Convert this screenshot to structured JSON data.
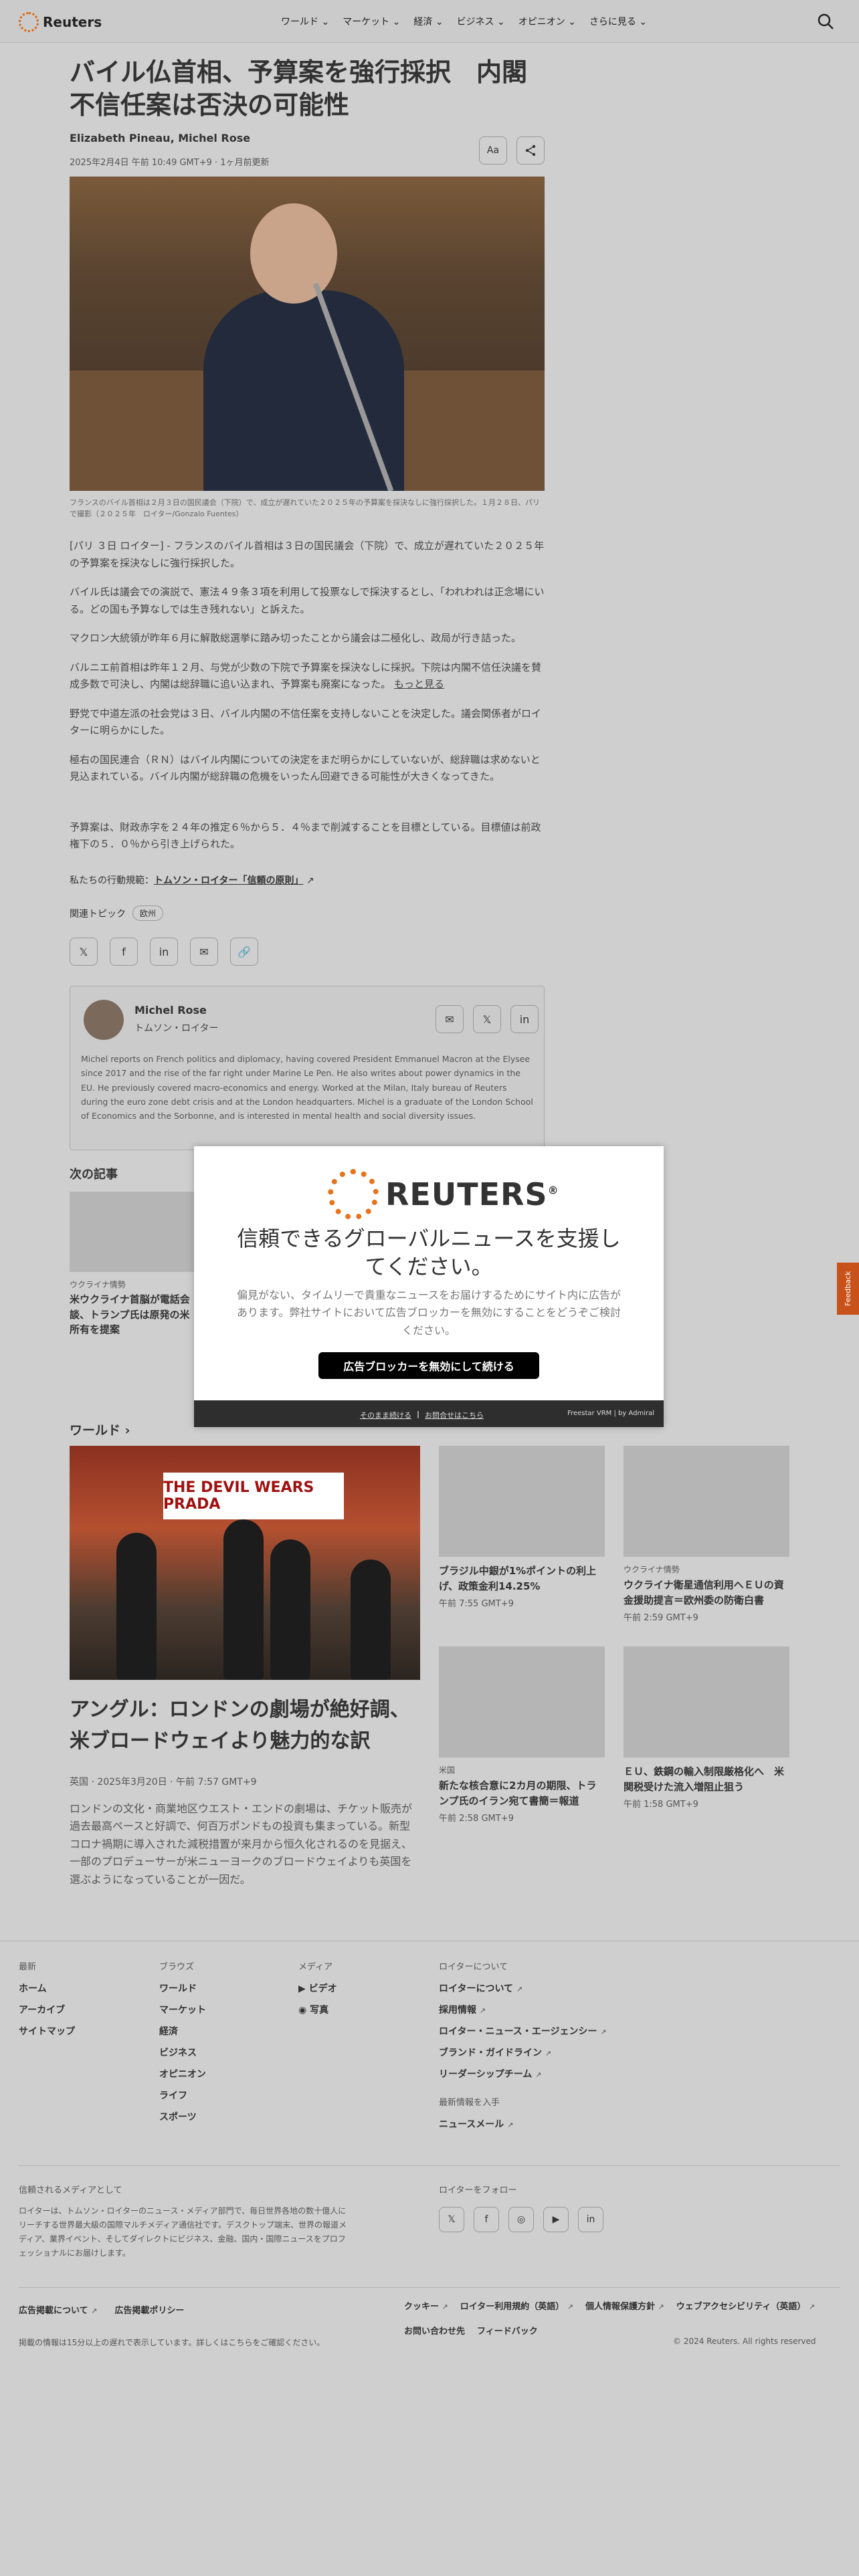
{
  "header": {
    "logo": "Reuters",
    "nav": [
      "ワールド ⌄",
      "マーケット ⌄",
      "経済 ⌄",
      "ビジネス ⌄",
      "オピニオン ⌄",
      "さらに見る ⌄"
    ],
    "search_icon": "search-icon"
  },
  "article": {
    "title": "バイル仏首相、予算案を強行採択　内閣不信任案は否決の可能性",
    "authors": "Elizabeth Pineau, Michel Rose",
    "dateline": "2025年2月4日 午前 10:49 GMT+9 · 1ヶ月前更新",
    "text_size_button": "Aa",
    "share_icon": "share-icon",
    "image_caption": "フランスのバイル首相は２月３日の国民議会（下院）で、成立が遅れていた２０２５年の予算案を採決なしに強行採択した。１月２８日、パリで撮影（２０２５年　ロイター/Gonzalo Fuentes）",
    "paragraphs": [
      "[パリ ３日 ロイター] - フランスのバイル首相は３日の国民議会（下院）で、成立が遅れていた２０２５年の予算案を採決なしに強行採択した。",
      "バイル氏は議会での演説で、憲法４９条３項を利用して投票なしで採決するとし、「われわれは正念場にいる。どの国も予算なしでは生き残れない」と訴えた。",
      "マクロン大統領が昨年６月に解散総選挙に踏み切ったことから議会は二極化し、政局が行き詰った。",
      "バルニエ前首相は昨年１２月、与党が少数の下院で予算案を採決なしに採択。下院は内閣不信任決議を賛成多数で可決し、内閣は総辞職に追い込まれ、予算案も廃案になった。",
      "野党で中道左派の社会党は３日、バイル内閣の不信任案を支持しないことを決定した。議会関係者がロイターに明らかにした。",
      "極右の国民連合（ＲＮ）はバイル内閣についての決定をまだ明らかにしていないが、総辞職は求めないと見込まれている。バイル内閣が総辞職の危機をいったん回避できる可能性が大きくなってきた。",
      "予算案は、財政赤字を２４年の推定６％から５．４％まで削減することを目標としている。目標値は前政権下の５．０％から引き上げられた。"
    ],
    "more_link": "もっと見る",
    "policy_prefix": "私たちの行動規範：",
    "policy_link": "トムソン・ロイター「信頼の原則」",
    "external_icon": "↗",
    "topics_label": "関連トピック",
    "topic": "欧州"
  },
  "share_icons": [
    "𝕏",
    "f",
    "in",
    "✉",
    "🔗"
  ],
  "author": {
    "name": "Michel Rose",
    "org": "トムソン・ロイター",
    "bio": "Michel reports on French politics and diplomacy, having covered President Emmanuel Macron at the Elysee since 2017 and the rise of the far right under Marine Le Pen. He also writes about power dynamics in the EU. He previously covered macro-economics and energy. Worked at the Milan, Italy bureau of Reuters during the euro zone debt crisis and at the London headquarters. Michel is a graduate of the London School of Economics and the Sorbonne, and is interested in mental health and social diversity issues.",
    "buttons": [
      "✉",
      "𝕏",
      "in"
    ]
  },
  "next": {
    "label": "次の記事",
    "tag": "ウクライナ情勢",
    "title": "米ウクライナ首脳が電話会談、トランプ氏は原発の米所有を提案"
  },
  "modal": {
    "logo": "REUTERS",
    "registered": "®",
    "title": "信頼できるグローバルニュースを支援してください。",
    "body": "偏見がない、タイムリーで貴重なニュースをお届けするためにサイト内に広告があります。弊社サイトにおいて広告ブロッカーを無効にすることをどうぞご検討ください。",
    "button": "広告ブロッカーを無効にして続ける",
    "continue_link": "そのまま続ける",
    "separator": "|",
    "question_link": "お問合せはこちら",
    "brand": "Freestar VRM | by Admiral"
  },
  "feedback": "Feedback",
  "world": {
    "label": "ワールド ›",
    "big_image_sign": "THE DEVIL WEARS PRADA",
    "big": {
      "title": "アングル：ロンドンの劇場が絶好調、米ブロードウェイより魅力的な訳",
      "meta": "英国 · 2025年3月20日 · 午前 7:57 GMT+9",
      "desc": "ロンドンの文化・商業地区ウエスト・エンドの劇場は、チケット販売が過去最高ペースと好調で、何百万ポンドもの投資も集まっている。新型コロナ禍期に導入された減税措置が来月から恒久化されるのを見据え、一部のプロデューサーが米ニューヨークのブロードウェイよりも英国を選ぶようになっていることが一因だ。"
    },
    "cards": [
      {
        "tag": "",
        "title": "ブラジル中銀が1%ポイントの利上げ、政策金利14.25%",
        "time": "午前 7:55 GMT+9"
      },
      {
        "tag": "ウクライナ情勢",
        "title": "ウクライナ衛星通信利用へＥＵの資金援助提言＝欧州委の防衛白書",
        "time": "午前 2:59 GMT+9"
      },
      {
        "tag": "米国",
        "title": "新たな核合意に2カ月の期限、トランプ氏のイラン宛て書簡＝報道",
        "time": "午前 2:58 GMT+9"
      },
      {
        "tag": "",
        "title": "ＥＵ、鉄鋼の輸入制限厳格化へ　米関税受けた流入増阻止狙う",
        "time": "午前 1:58 GMT+9"
      }
    ]
  },
  "footer": {
    "col1": {
      "head": "最新",
      "items": [
        "ホーム",
        "アーカイブ",
        "サイトマップ"
      ]
    },
    "col2": {
      "head": "ブラウズ",
      "items": [
        "ワールド",
        "マーケット",
        "経済",
        "ビジネス",
        "オピニオン",
        "ライフ",
        "スポーツ"
      ]
    },
    "col3": {
      "head": "メディア",
      "items": [
        "ビデオ",
        "写真"
      ]
    },
    "col4": {
      "head": "ロイターについて",
      "items": [
        "ロイターについて",
        "採用情報",
        "ロイター・ニュース・エージェンシー",
        "ブランド・ガイドライン",
        "リーダーシップチーム"
      ]
    },
    "latest_head": "最新情報を入手",
    "newsletter": "ニュースメール",
    "trusted_head": "信頼されるメディアとして",
    "trusted_text": "ロイターは、トムソン・ロイターのニュース・メディア部門で、毎日世界各地の数十億人にリーチする世界最大級の国際マルチメディア通信社です。デスクトップ端末、世界の報道メディア、業界イベント、そしてダイレクトにビジネス、金融、国内・国際ニュースをプロフェッショナルにお届けします。",
    "follow_head": "ロイターをフォロー",
    "socials": [
      "𝕏",
      "f",
      "◎",
      "▶",
      "in"
    ],
    "legal_left": [
      "広告掲載について",
      "広告掲載ポリシー"
    ],
    "legal_right": [
      "クッキー",
      "ロイター利用規約（英語）",
      "個人情報保護方針",
      "ウェブアクセシビリティ（英語）",
      "お問い合わせ先",
      "フィードバック"
    ],
    "delay": "掲載の情報は15分以上の遅れで表示しています。詳しくはこちらをご確認ください。",
    "copyright": "© 2024 Reuters. All rights reserved"
  }
}
